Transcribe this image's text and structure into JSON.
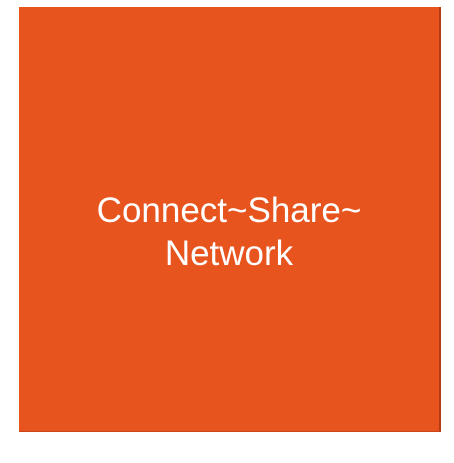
{
  "tile": {
    "line1": "Connect~Share~",
    "line2": "Network",
    "background_color": "#e8541e",
    "text_color": "#ffffff"
  }
}
